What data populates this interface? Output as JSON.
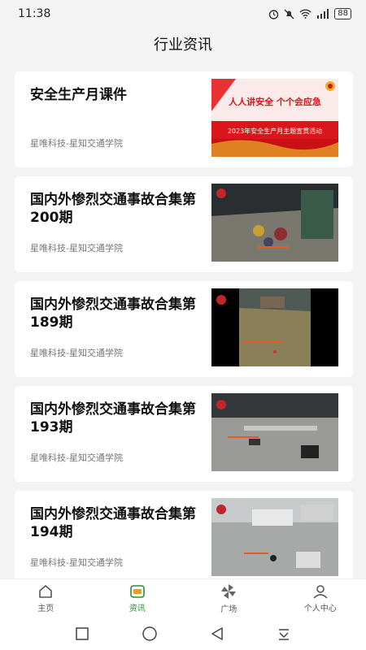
{
  "status": {
    "time": "11:38",
    "battery": "88"
  },
  "header": {
    "title": "行业资讯"
  },
  "articles": [
    {
      "title": "安全生产月课件",
      "source": "星唯科技-星知交通学院",
      "banner_main": "人人讲安全 个个会应急",
      "banner_sub": "2023年安全生产月主题宣贯活动"
    },
    {
      "title": "国内外惨烈交通事故合集第200期",
      "source": "星唯科技-星知交通学院"
    },
    {
      "title": "国内外惨烈交通事故合集第189期",
      "source": "星唯科技-星知交通学院"
    },
    {
      "title": "国内外惨烈交通事故合集第193期",
      "source": "星唯科技-星知交通学院"
    },
    {
      "title": "国内外惨烈交通事故合集第194期",
      "source": "星唯科技-星知交通学院"
    }
  ],
  "nav": {
    "home": "主页",
    "news": "资讯",
    "plaza": "广场",
    "profile": "个人中心"
  },
  "colors": {
    "accent": "#2d8a3a",
    "banner_red": "#d8161c"
  }
}
